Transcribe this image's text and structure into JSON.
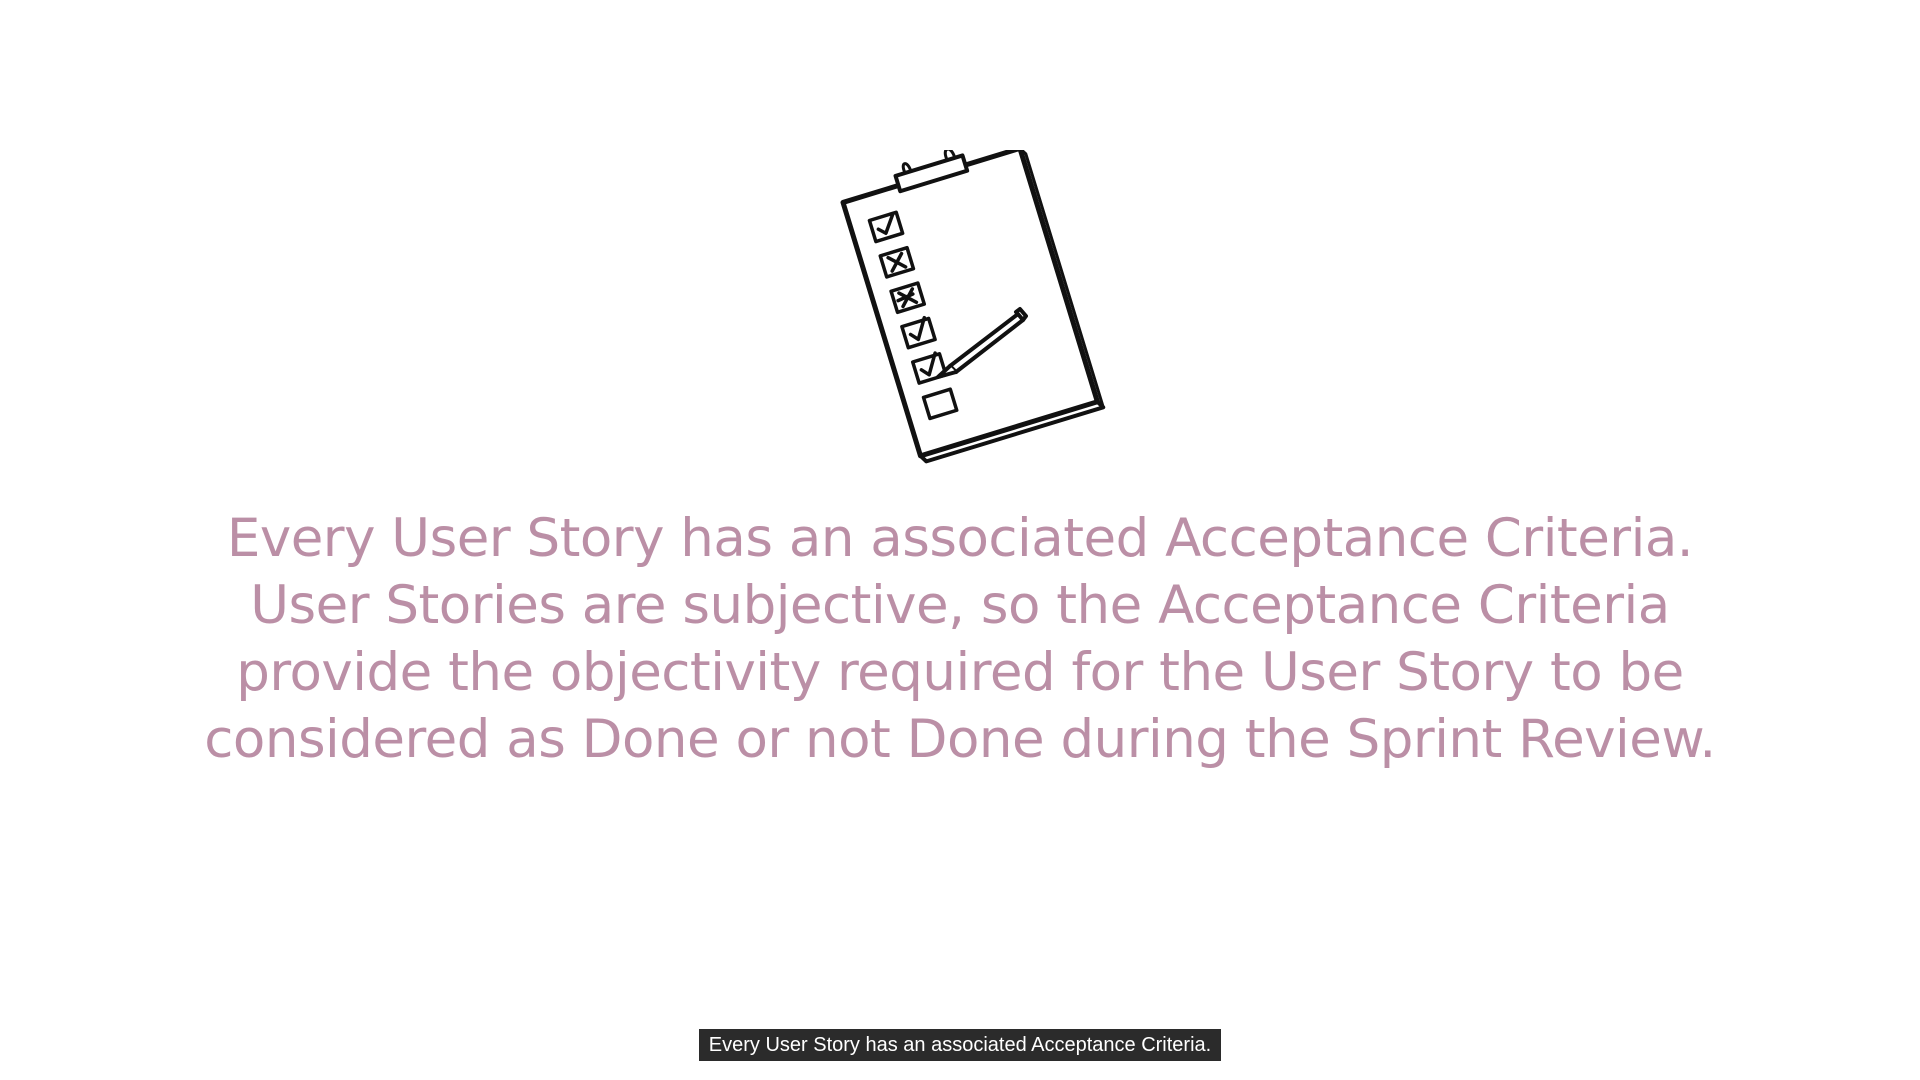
{
  "slide": {
    "lines": [
      "Every User Story has an associated Acceptance Criteria.",
      "User Stories are subjective, so the Acceptance Criteria",
      "provide the objectivity required for the User Story to be",
      "considered as Done or not Done during the Sprint Review."
    ],
    "text_color": "#bb8fa6",
    "illustration_icon": "clipboard-checklist-icon"
  },
  "caption": {
    "text": "Every User Story has an associated Acceptance Criteria."
  }
}
